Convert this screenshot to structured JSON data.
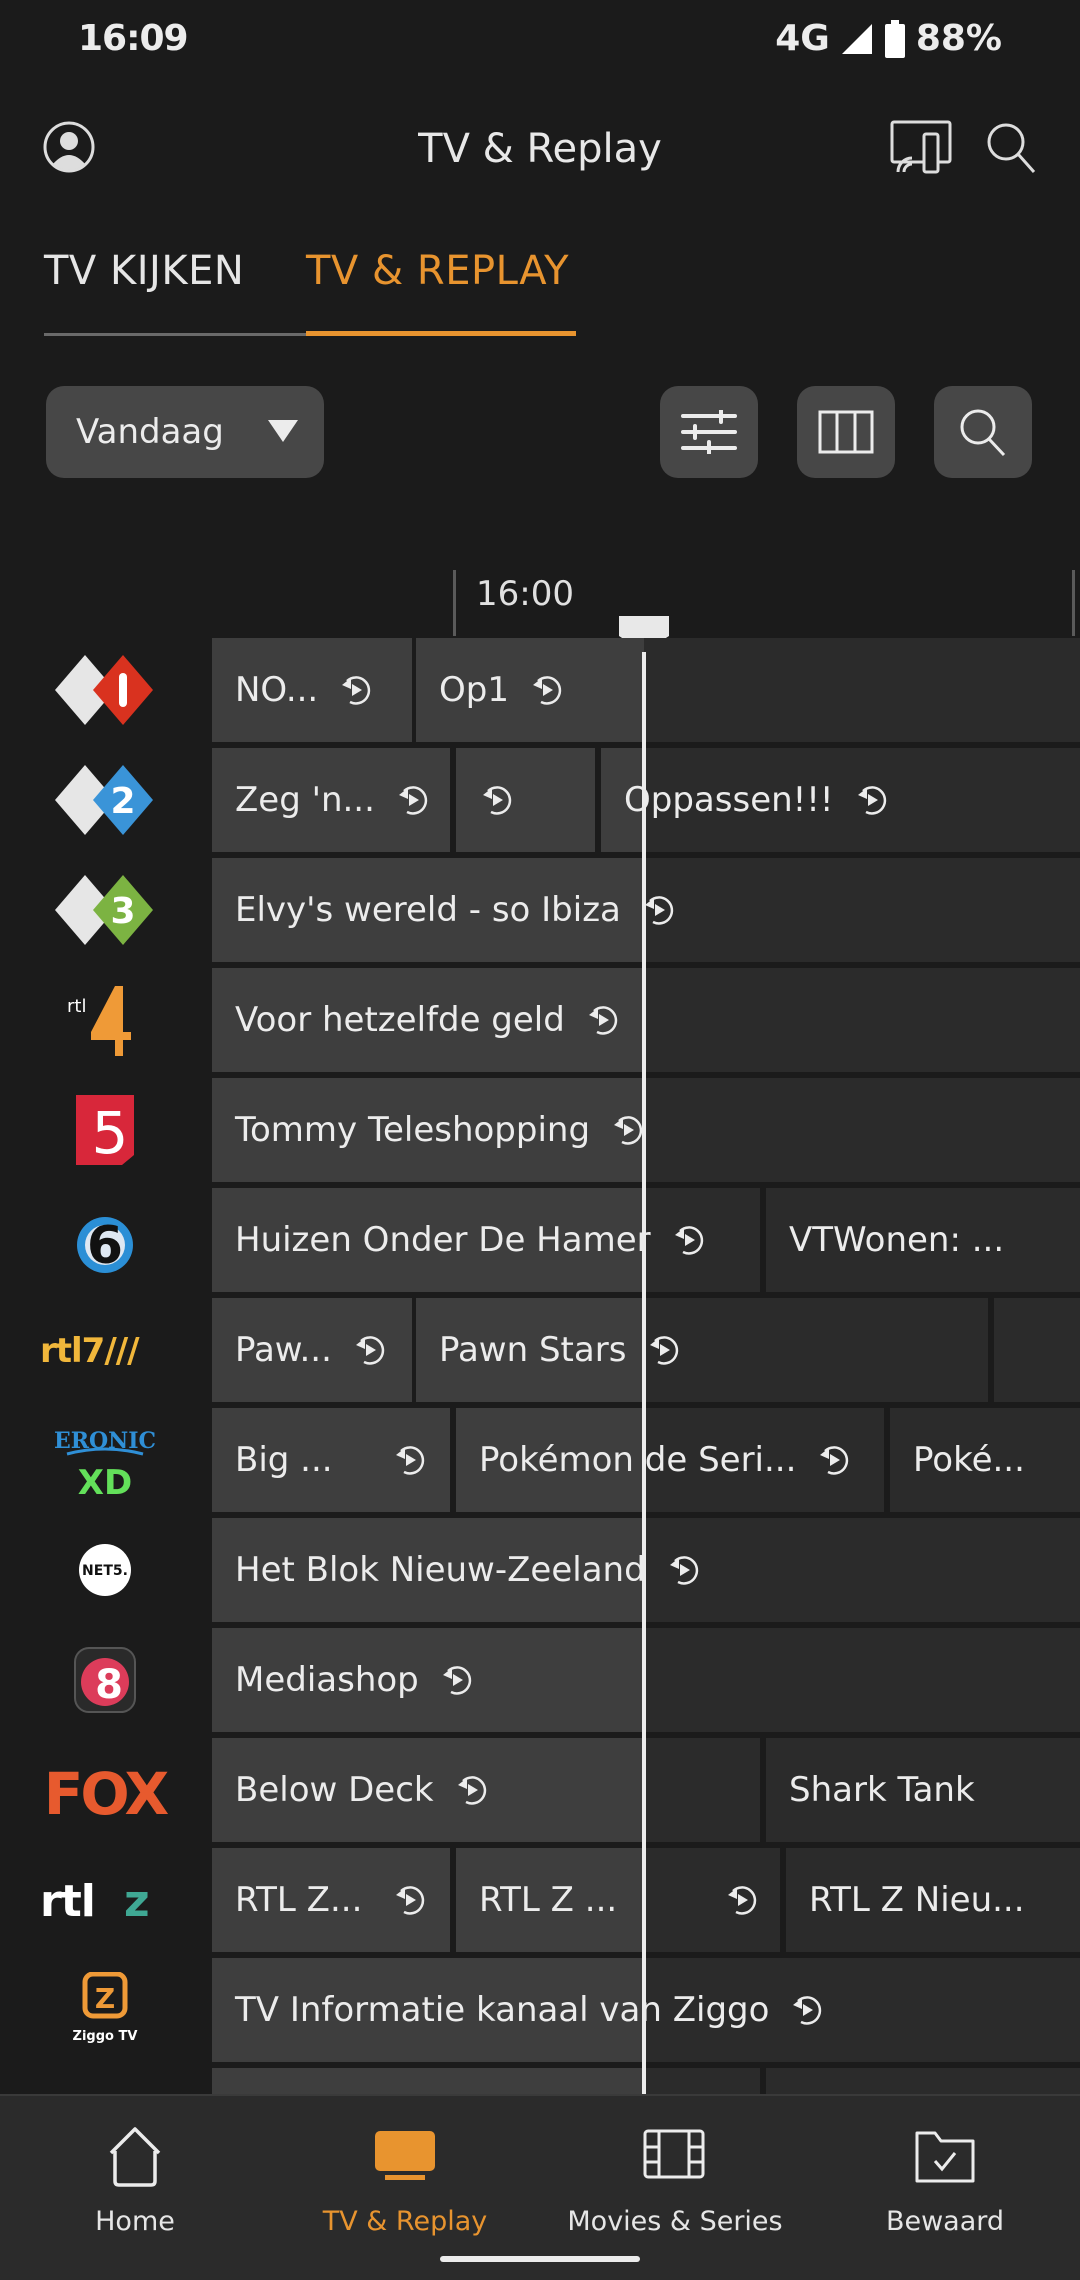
{
  "status_bar": {
    "time": "16:09",
    "network": "4G",
    "battery": "88%"
  },
  "app_bar": {
    "title": "TV & Replay",
    "icons": [
      "profile-icon",
      "cast-icon",
      "search-icon"
    ]
  },
  "tabs": [
    {
      "label": "TV KIJKEN",
      "active": false
    },
    {
      "label": "TV & REPLAY",
      "active": true
    }
  ],
  "toolbar": {
    "date_select": "Vandaag",
    "buttons": [
      "filter-icon",
      "columns-icon",
      "search-icon"
    ]
  },
  "timeline": {
    "label": "16:00"
  },
  "channels": [
    {
      "name": "NPO 1",
      "programs": [
        {
          "title": "NO...",
          "replay": true
        },
        {
          "title": "Op1",
          "replay": true
        }
      ]
    },
    {
      "name": "NPO 2",
      "programs": [
        {
          "title": "Zeg 'n...",
          "replay": true
        },
        {
          "title": "",
          "replay": true
        },
        {
          "title": "Oppassen!!!",
          "replay": true
        }
      ]
    },
    {
      "name": "NPO 3",
      "programs": [
        {
          "title": "Elvy's wereld - so Ibiza",
          "replay": true
        }
      ]
    },
    {
      "name": "RTL 4",
      "programs": [
        {
          "title": "Voor hetzelfde geld",
          "replay": true
        }
      ]
    },
    {
      "name": "RTL 5",
      "programs": [
        {
          "title": "Tommy Teleshopping",
          "replay": true
        }
      ]
    },
    {
      "name": "SBS 6",
      "programs": [
        {
          "title": "Huizen Onder De Hamer",
          "replay": true
        },
        {
          "title": "VTWonen: ...",
          "replay": false
        }
      ]
    },
    {
      "name": "RTL 7",
      "programs": [
        {
          "title": "Paw...",
          "replay": true
        },
        {
          "title": "Pawn Stars",
          "replay": true
        },
        {
          "title": "",
          "replay": false
        }
      ]
    },
    {
      "name": "Veronica / Disney XD",
      "programs": [
        {
          "title": "Big ...",
          "replay": true
        },
        {
          "title": "Pokémon de Seri...",
          "replay": true
        },
        {
          "title": "Poké...",
          "replay": false
        }
      ]
    },
    {
      "name": "NET5",
      "programs": [
        {
          "title": "Het Blok Nieuw-Zeeland",
          "replay": true
        }
      ]
    },
    {
      "name": "RTL 8",
      "programs": [
        {
          "title": "Mediashop",
          "replay": true
        }
      ]
    },
    {
      "name": "FOX",
      "programs": [
        {
          "title": "Below Deck",
          "replay": true
        },
        {
          "title": "Shark Tank",
          "replay": false
        }
      ]
    },
    {
      "name": "RTL Z",
      "programs": [
        {
          "title": "RTL Z...",
          "replay": true
        },
        {
          "title": "RTL Z ...",
          "replay": true
        },
        {
          "title": "RTL Z Nieu...",
          "replay": false
        }
      ]
    },
    {
      "name": "Ziggo TV",
      "logo_text": "Ziggo TV",
      "programs": [
        {
          "title": "TV Informatie kanaal van Ziggo",
          "replay": true
        }
      ]
    }
  ],
  "bottom_nav": [
    {
      "label": "Home",
      "icon": "home-icon",
      "active": false
    },
    {
      "label": "TV & Replay",
      "icon": "tv-icon",
      "active": true
    },
    {
      "label": "Movies & Series",
      "icon": "film-icon",
      "active": false
    },
    {
      "label": "Bewaard",
      "icon": "saved-folder-icon",
      "active": false
    }
  ],
  "colors": {
    "accent": "#e8942f",
    "background": "#1b1b1b",
    "cell_past": "#3e3e3e",
    "cell_future": "#2b2b2b"
  }
}
